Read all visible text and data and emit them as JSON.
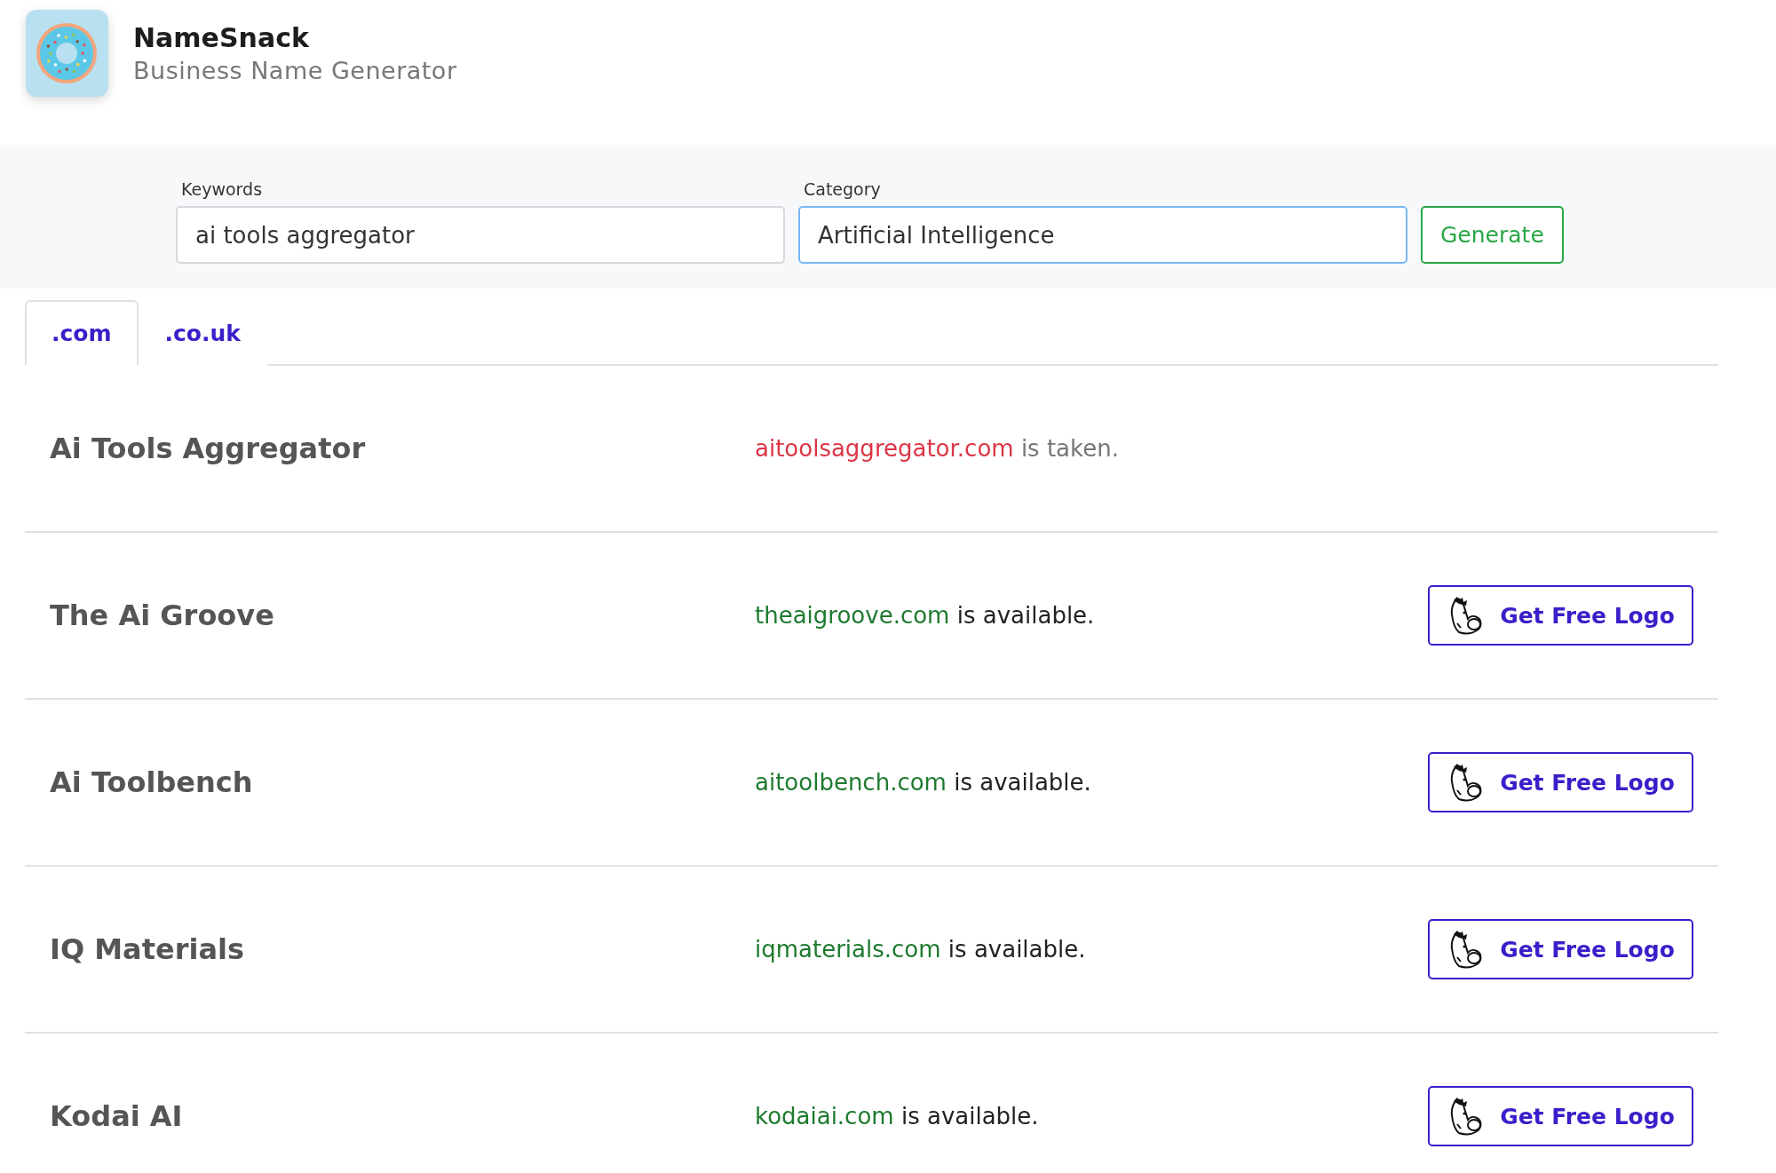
{
  "brand": {
    "name": "NameSnack",
    "tagline": "Business Name Generator"
  },
  "search": {
    "fields": [
      {
        "label": "Keywords",
        "value": "ai tools aggregator",
        "focused": false
      },
      {
        "label": "Category",
        "value": "Artificial Intelligence",
        "focused": true
      }
    ],
    "button": "Generate"
  },
  "tabs": [
    {
      "label": ".com",
      "selected": true
    },
    {
      "label": ".co.uk",
      "selected": false
    }
  ],
  "results": [
    {
      "name": "Ai Tools Aggregator",
      "domain": "aitoolsaggregator.com",
      "status": "is taken.",
      "available": false
    },
    {
      "name": "The Ai Groove",
      "domain": "theaigroove.com",
      "status": "is available.",
      "available": true,
      "button": "Get Free Logo"
    },
    {
      "name": "Ai Toolbench",
      "domain": "aitoolbench.com",
      "status": "is available.",
      "available": true,
      "button": "Get Free Logo"
    },
    {
      "name": "IQ Materials",
      "domain": "iqmaterials.com",
      "status": "is available.",
      "available": true,
      "button": "Get Free Logo"
    },
    {
      "name": "Kodai AI",
      "domain": "kodaiai.com",
      "status": "is available.",
      "available": true,
      "button": "Get Free Logo"
    }
  ]
}
